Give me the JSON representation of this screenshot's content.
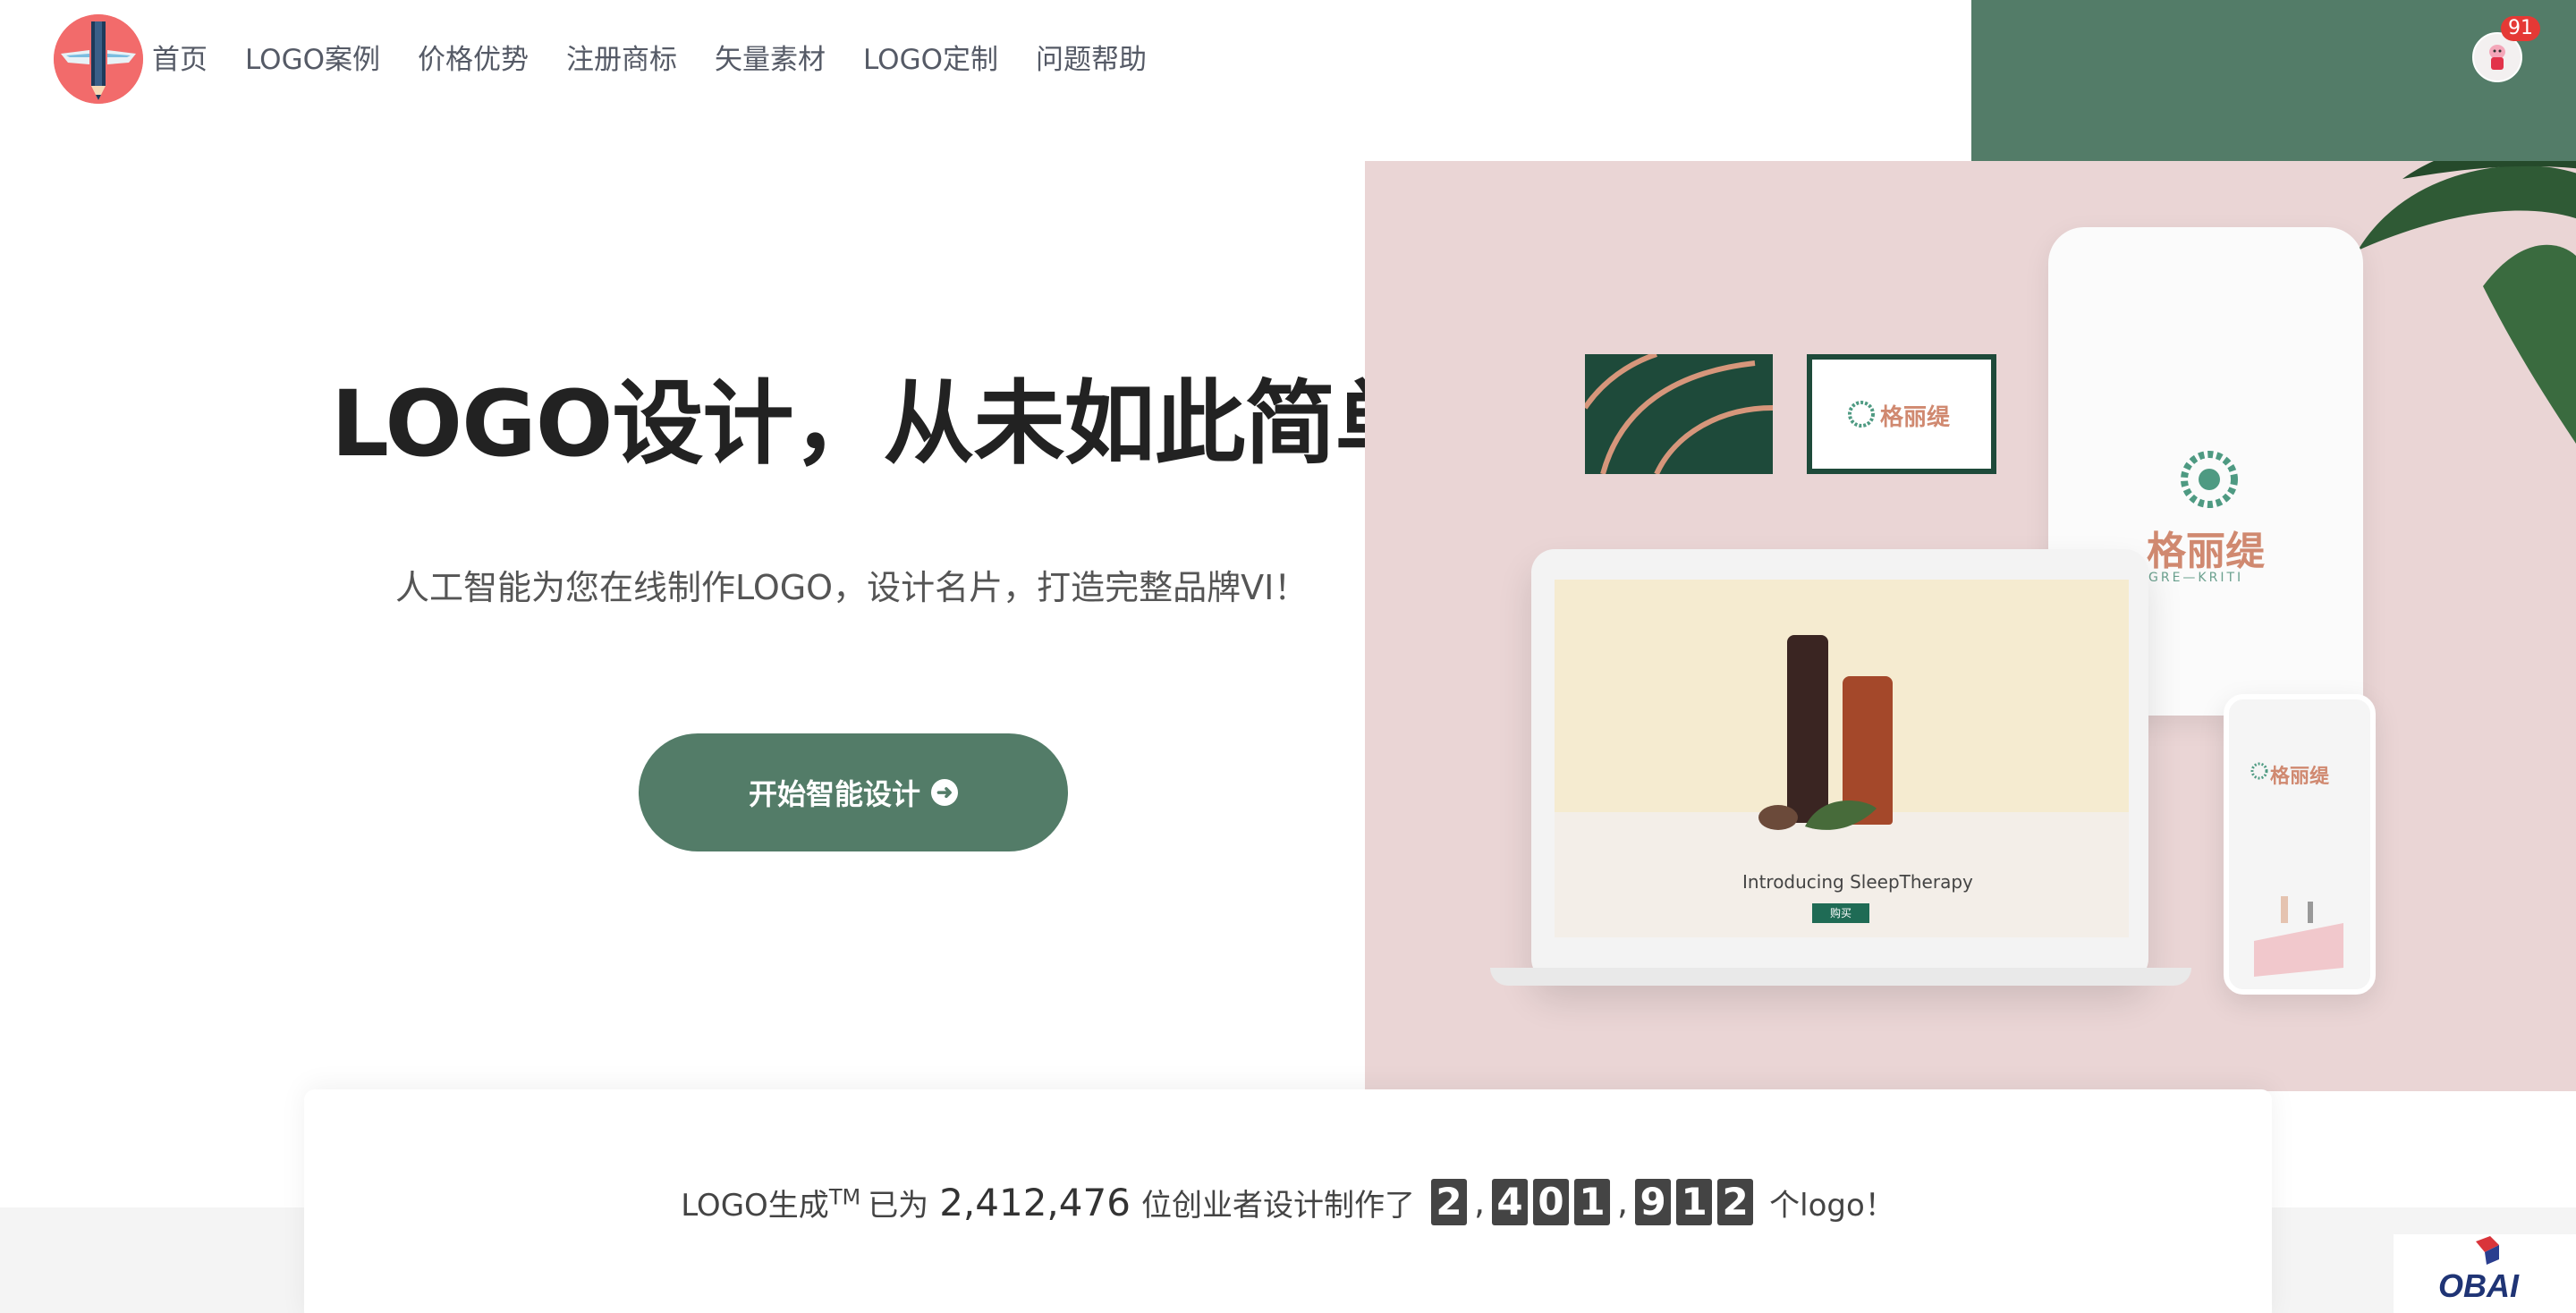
{
  "header": {
    "nav": [
      "首页",
      "LOGO案例",
      "价格优势",
      "注册商标",
      "矢量素材",
      "LOGO定制",
      "问题帮助"
    ],
    "notification_count": "91"
  },
  "hero": {
    "title_part1": "LOGO设计，",
    "title_part2": "从未如此简单!",
    "subtitle": "人工智能为您在线制作LOGO，设计名片，打造完整品牌VI！",
    "cta_label": "开始智能设计"
  },
  "mockup": {
    "brand_cn": "格丽缇",
    "brand_en": "GRE—KRITI",
    "laptop_caption": "Introducing SleepTherapy",
    "buy_label": "购买"
  },
  "stats": {
    "prefix": "LOGO生成",
    "tm": "TM",
    "mid1": "已为",
    "entrepreneurs": "2,412,476",
    "mid2": "位创业者设计制作了",
    "logo_digits": [
      "2",
      "4",
      "0",
      "1",
      "9",
      "1",
      "2"
    ],
    "suffix": "个logo！"
  },
  "watermark": {
    "text": "OBAI"
  },
  "colors": {
    "brand_green": "#537c68",
    "hero_pink": "#ead5d5",
    "highlight": "#a9c3b4",
    "badge_red": "#e53935"
  }
}
